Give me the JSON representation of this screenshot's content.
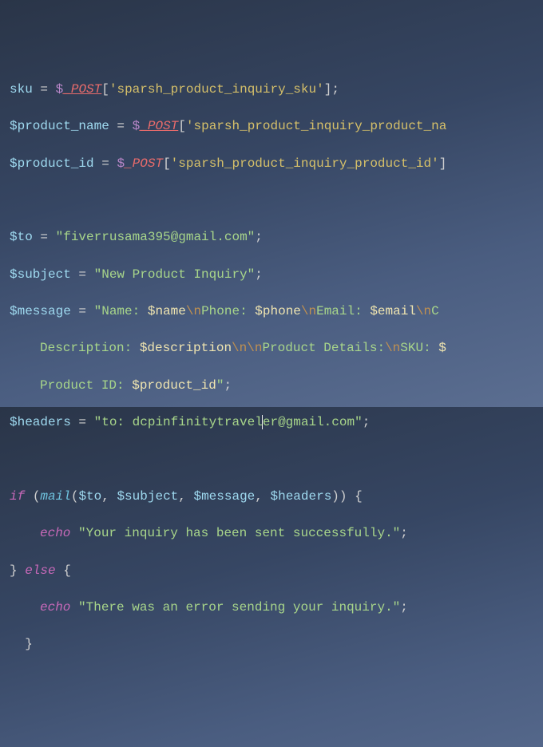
{
  "l1_sku": "sku",
  "l1_post": "_POST",
  "l1_key": "sparsh_product_inquiry_sku",
  "l2_var": "$product_name",
  "l2_key": "sparsh_product_inquiry_product_na",
  "l3_var": "$product_id",
  "l3_key": "sparsh_product_inquiry_product_id",
  "to_var": "$to",
  "to_val": "\"fiverrusama395@gmail.com\"",
  "sub_var": "$subject",
  "sub_val": "\"New Product Inquiry\"",
  "msg_var": "$message",
  "msg_p1": "\"Name: ",
  "msg_name": "$name",
  "msg_e1": "\\n",
  "msg_p2": "Phone: ",
  "msg_phone": "$phone",
  "msg_e2": "\\n",
  "msg_p3": "Email: ",
  "msg_email": "$email",
  "msg_e3": "\\n",
  "msg_tail1": "C",
  "msg_l2a": "Description: ",
  "msg_desc": "$description",
  "msg_e4": "\\n\\n",
  "msg_l2b": "Product Details:",
  "msg_e5": "\\n",
  "msg_l2c": "SKU: ",
  "msg_tail2": "$",
  "msg_l3a": "Product ID: ",
  "msg_pid": "$product_id",
  "msg_l3b": "\"",
  "hd_var": "$headers",
  "hd_val_a": "\"to: dcpinfinitytravel",
  "hd_val_b": "er@gmail.com\"",
  "kw_if": "if",
  "fn_mail": "mail",
  "a1": "$to",
  "a2": "$subject",
  "a3": "$message",
  "a4": "$headers",
  "kw_echo": "echo",
  "echo1": "\"Your inquiry has been sent successfully.\"",
  "kw_else": "else",
  "echo2": "\"There was an error sending your inquiry.\"",
  "assign": " = ",
  "dol": "$",
  "semi": ";",
  "obr": "{",
  "cbr": "}",
  "obrk": "[",
  "cbrk": "]",
  "op": "(",
  "cp": ")",
  "comma": ", ",
  "q": "'"
}
